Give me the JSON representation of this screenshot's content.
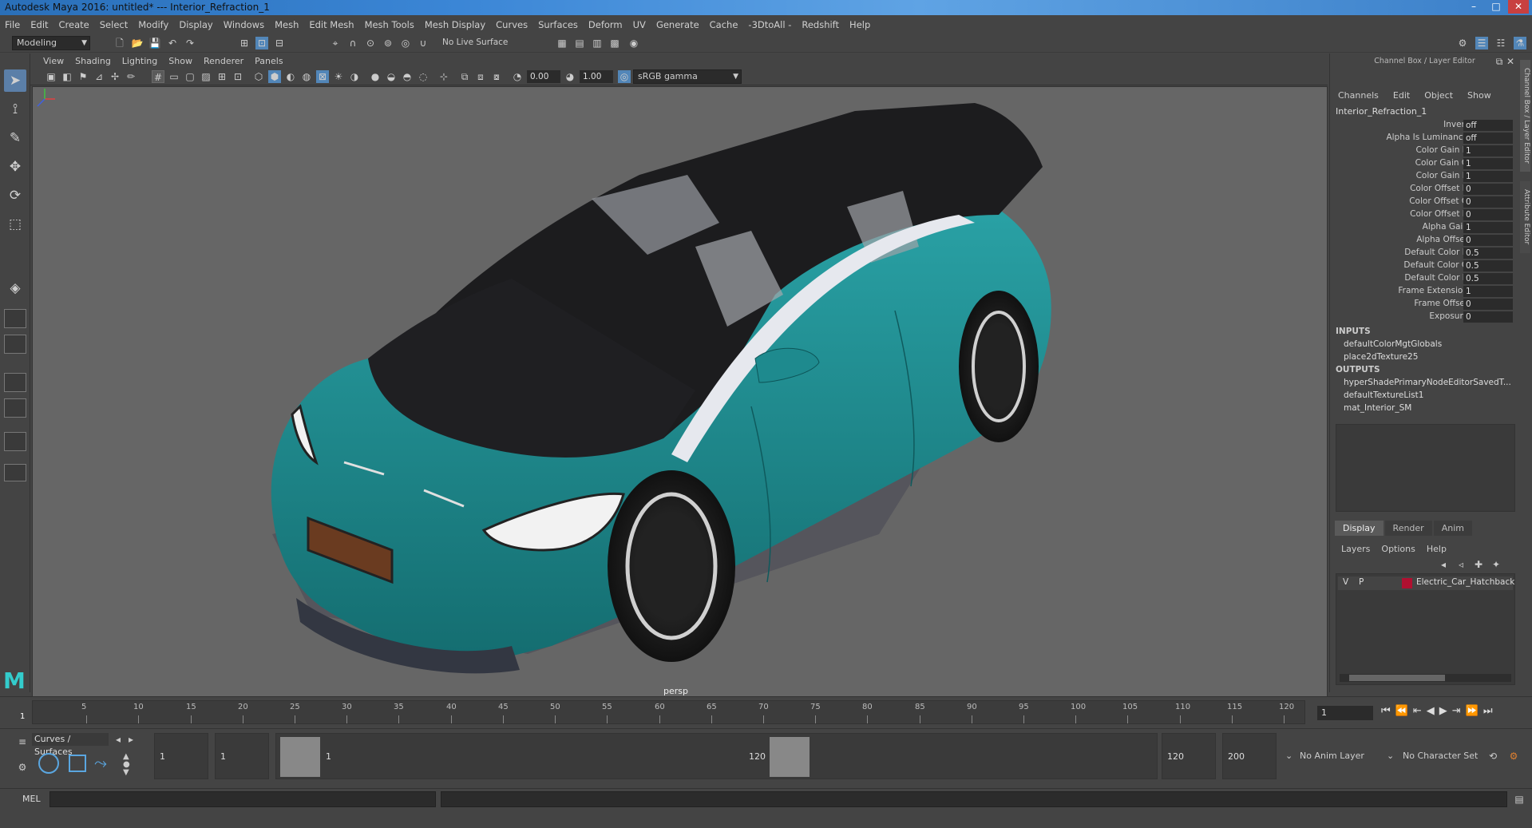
{
  "window": {
    "title": "Autodesk Maya 2016: untitled*   ---   Interior_Refraction_1"
  },
  "menubar": [
    "File",
    "Edit",
    "Create",
    "Select",
    "Modify",
    "Display",
    "Windows",
    "Mesh",
    "Edit Mesh",
    "Mesh Tools",
    "Mesh Display",
    "Curves",
    "Surfaces",
    "Deform",
    "UV",
    "Generate",
    "Cache",
    "-3DtoAll -",
    "Redshift",
    "Help"
  ],
  "statusline": {
    "mode": "Modeling",
    "live_surface": "No Live Surface"
  },
  "viewport_menu": [
    "View",
    "Shading",
    "Lighting",
    "Show",
    "Renderer",
    "Panels"
  ],
  "viewport_tools": {
    "exposure": "0.00",
    "gamma": "1.00",
    "colorspace": "sRGB gamma"
  },
  "viewport": {
    "camera": "persp"
  },
  "channel_box": {
    "title": "Channel Box / Layer Editor",
    "tabs": [
      "Channels",
      "Edit",
      "Object",
      "Show"
    ],
    "node": "Interior_Refraction_1",
    "attrs": [
      {
        "label": "Invert",
        "value": "off"
      },
      {
        "label": "Alpha Is Luminance",
        "value": "off"
      },
      {
        "label": "Color Gain R",
        "value": "1"
      },
      {
        "label": "Color Gain G",
        "value": "1"
      },
      {
        "label": "Color Gain B",
        "value": "1"
      },
      {
        "label": "Color Offset R",
        "value": "0"
      },
      {
        "label": "Color Offset G",
        "value": "0"
      },
      {
        "label": "Color Offset B",
        "value": "0"
      },
      {
        "label": "Alpha Gain",
        "value": "1"
      },
      {
        "label": "Alpha Offset",
        "value": "0"
      },
      {
        "label": "Default Color R",
        "value": "0.5"
      },
      {
        "label": "Default Color G",
        "value": "0.5"
      },
      {
        "label": "Default Color B",
        "value": "0.5"
      },
      {
        "label": "Frame Extension",
        "value": "1"
      },
      {
        "label": "Frame Offset",
        "value": "0"
      },
      {
        "label": "Exposure",
        "value": "0"
      }
    ],
    "inputs_label": "INPUTS",
    "inputs": [
      "defaultColorMgtGlobals",
      "place2dTexture25"
    ],
    "outputs_label": "OUTPUTS",
    "outputs": [
      "hyperShadePrimaryNodeEditorSavedT...",
      "defaultTextureList1",
      "mat_Interior_SM"
    ]
  },
  "layer_editor": {
    "tabs": [
      "Display",
      "Render",
      "Anim"
    ],
    "menu": [
      "Layers",
      "Options",
      "Help"
    ],
    "layer": {
      "v": "V",
      "p": "P",
      "name": "Electric_Car_Hatchback",
      "color": "#b01030"
    }
  },
  "side_tabs": [
    "Channel Box / Layer Editor",
    "Attribute Editor"
  ],
  "timeline": {
    "ticks": [
      "5",
      "10",
      "15",
      "20",
      "25",
      "30",
      "35",
      "40",
      "45",
      "50",
      "55",
      "60",
      "65",
      "70",
      "75",
      "80",
      "85",
      "90",
      "95",
      "100",
      "105",
      "110",
      "115",
      "120"
    ],
    "start_label": "1",
    "current_frame": "1"
  },
  "range": {
    "shelf_tab": "Curves / Surfaces",
    "start": "1",
    "min": "1",
    "slider_start": "1",
    "slider_end": "120",
    "end": "120",
    "max": "200",
    "anim_layer": "No Anim Layer",
    "char_set": "No Character Set"
  },
  "cmdline": {
    "label": "MEL"
  },
  "colors": {
    "car_body": "#1e8a8e",
    "accent": "#5286b8",
    "layer": "#b01030"
  }
}
